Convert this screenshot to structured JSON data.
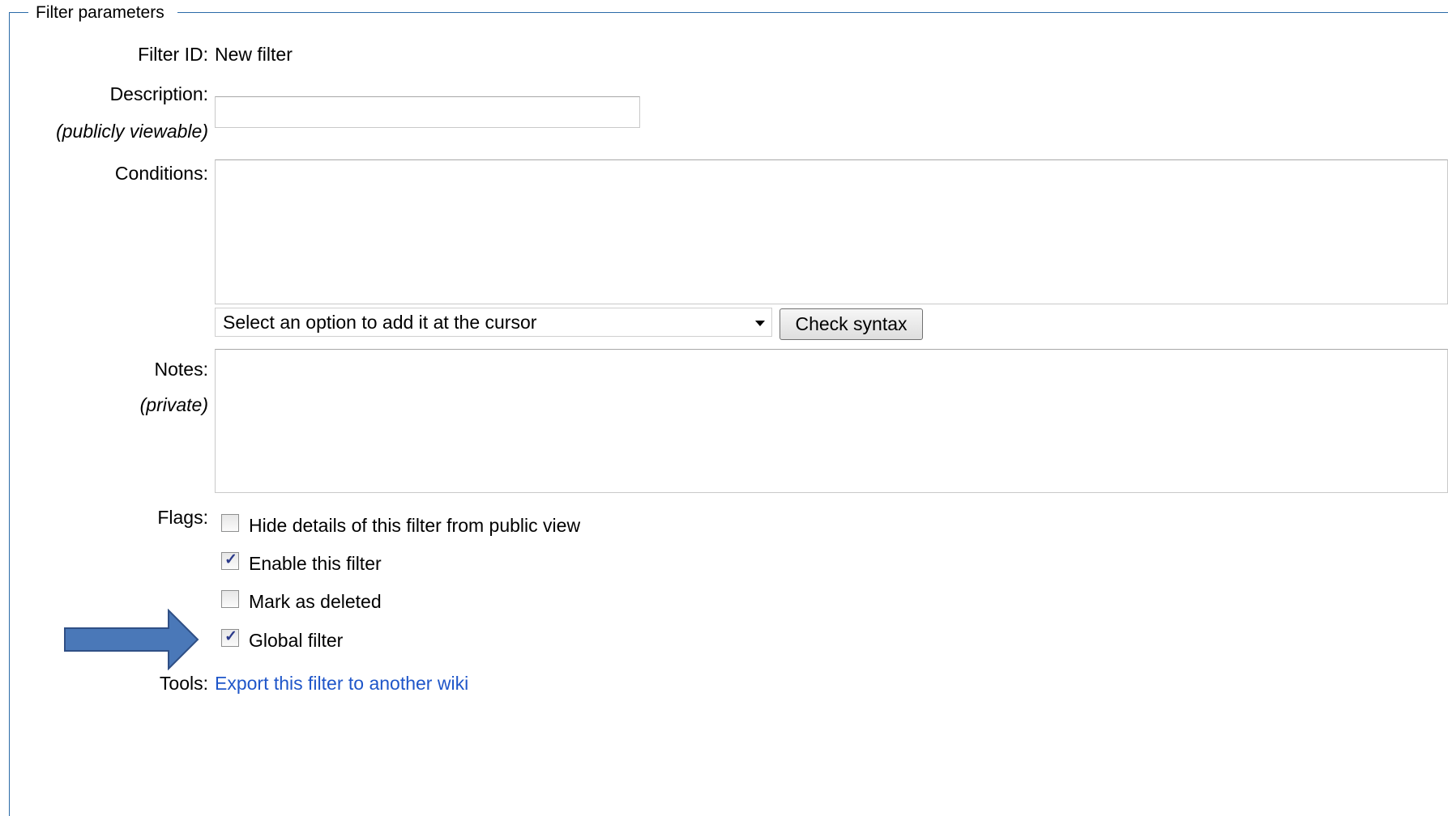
{
  "fieldset": {
    "legend": "Filter parameters"
  },
  "filter_id": {
    "label": "Filter ID:",
    "value": "New filter"
  },
  "description": {
    "label": "Description:",
    "sublabel": "(publicly viewable)",
    "value": ""
  },
  "conditions": {
    "label": "Conditions:",
    "value": "",
    "select_selected": "Select an option to add it at the cursor",
    "check_syntax_label": "Check syntax"
  },
  "notes": {
    "label": "Notes:",
    "sublabel": "(private)",
    "value": ""
  },
  "flags": {
    "label": "Flags:",
    "items": [
      {
        "label": "Hide details of this filter from public view",
        "checked": false
      },
      {
        "label": "Enable this filter",
        "checked": true
      },
      {
        "label": "Mark as deleted",
        "checked": false
      },
      {
        "label": "Global filter",
        "checked": true
      }
    ]
  },
  "tools": {
    "label": "Tools:",
    "link": "Export this filter to another wiki"
  },
  "colors": {
    "fieldset_border": "#2a6aa8",
    "link": "#1f56c9",
    "arrow_fill": "#4a78b8",
    "arrow_stroke": "#2f4f85"
  },
  "annotation": {
    "icon": "right-arrow-icon"
  }
}
